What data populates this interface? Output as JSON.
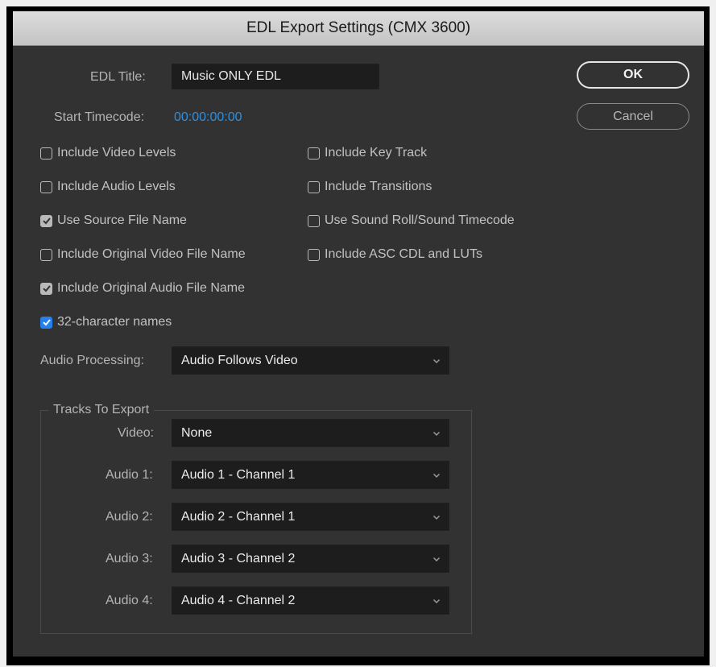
{
  "window": {
    "title": "EDL Export Settings (CMX 3600)"
  },
  "edl_title": {
    "label": "EDL Title:",
    "value": "Music ONLY EDL"
  },
  "start_timecode": {
    "label": "Start Timecode:",
    "value": "00:00:00:00"
  },
  "buttons": {
    "ok": "OK",
    "cancel": "Cancel"
  },
  "options": {
    "include_video_levels": {
      "label": "Include Video Levels",
      "checked": false
    },
    "include_audio_levels": {
      "label": "Include Audio Levels",
      "checked": false
    },
    "use_source_file_name": {
      "label": "Use Source File Name",
      "checked": true
    },
    "include_original_video_file_name": {
      "label": "Include Original Video File Name",
      "checked": false
    },
    "include_original_audio_file_name": {
      "label": "Include Original Audio File Name",
      "checked": true
    },
    "thirty_two_character_names": {
      "label": "32-character names",
      "checked": true
    },
    "include_key_track": {
      "label": "Include Key Track",
      "checked": false
    },
    "include_transitions": {
      "label": "Include Transitions",
      "checked": false
    },
    "use_sound_roll": {
      "label": "Use Sound Roll/Sound Timecode",
      "checked": false
    },
    "include_asc_cdl": {
      "label": "Include ASC CDL and LUTs",
      "checked": false
    }
  },
  "audio_processing": {
    "label": "Audio Processing:",
    "value": "Audio Follows Video"
  },
  "tracks": {
    "group_title": "Tracks To Export",
    "video": {
      "label": "Video:",
      "value": "None"
    },
    "audio1": {
      "label": "Audio 1:",
      "value": "Audio 1 - Channel 1"
    },
    "audio2": {
      "label": "Audio 2:",
      "value": "Audio 2 - Channel 1"
    },
    "audio3": {
      "label": "Audio 3:",
      "value": "Audio 3 - Channel 2"
    },
    "audio4": {
      "label": "Audio 4:",
      "value": "Audio 4 - Channel 2"
    }
  },
  "colors": {
    "dialog_bg": "#323232",
    "field_bg": "#1d1d1d",
    "timecode_blue": "#2f8fe0",
    "checkbox_accent": "#2680eb"
  }
}
